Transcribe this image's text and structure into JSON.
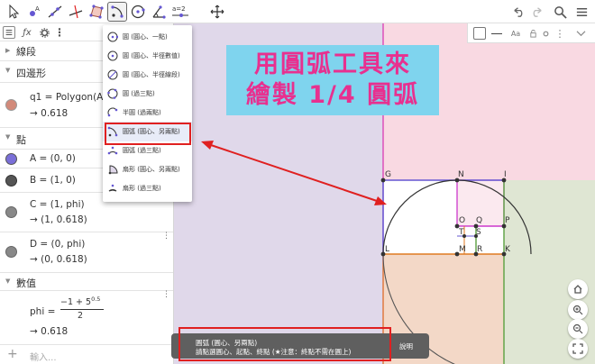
{
  "toolbar": {
    "tools": [
      "move-tool",
      "point-tool",
      "line-tool",
      "perpendicular-tool",
      "polygon-tool",
      "circle-arc-tool",
      "circle-tool",
      "angle-tool",
      "slider-tool",
      "move-view-tool"
    ],
    "slider_label": "a=2",
    "undo_icon": "undo-icon",
    "redo_icon": "redo-icon",
    "search_icon": "search-icon",
    "menu_icon": "menu-icon"
  },
  "algebra": {
    "groups": {
      "segment": "線段",
      "polygon": "四邊形",
      "point": "點",
      "number": "數值"
    },
    "q1": {
      "def": "q1 = Polygon(A,",
      "val": "→ 0.618",
      "color": "#d28a7a"
    },
    "A": {
      "def": "A = (0, 0)",
      "color": "#7a6fd8"
    },
    "B": {
      "def": "B = (1, 0)",
      "color": "#555555"
    },
    "C": {
      "def": "C = (1, phi)",
      "val": "→ (1, 0.618)",
      "color": "#888888"
    },
    "D": {
      "def": "D = (0, phi)",
      "val": "→ (0, 0.618)",
      "color": "#888888"
    },
    "phi": {
      "lhs": "phi =",
      "num": "−1 + 5",
      "exp": "0.5",
      "den": "2",
      "val": "→ 0.618"
    },
    "input_placeholder": "輸入..."
  },
  "dropdown": {
    "items": [
      "圓 (圓心、一點)",
      "圓 (圓心、半徑數值)",
      "圓 (圓心、半徑線段)",
      "圓 (過三點)",
      "半圓 (過兩點)",
      "圓弧 (圓心、另兩點)",
      "圓弧 (過三點)",
      "扇形 (圓心、另兩點)",
      "扇形 (過三點)"
    ],
    "selected_index": 5
  },
  "banner": {
    "line1": "用圓弧工具來",
    "line2": "繪製 1/4 圓弧"
  },
  "graphics": {
    "labels": [
      "G",
      "N",
      "I",
      "O",
      "Q",
      "P",
      "T",
      "S",
      "M",
      "R",
      "K",
      "L"
    ]
  },
  "tooltip": {
    "line1": "圓弧 (圓心、另兩點)",
    "line2": "請點選圓心、起點、終點 (★注意：終點不需在圓上)",
    "help": "說明"
  },
  "colors": {
    "accent": "#6557d2",
    "highlight_red": "#e02020",
    "banner_bg": "#7fd4ee",
    "banner_text": "#e8308f"
  }
}
